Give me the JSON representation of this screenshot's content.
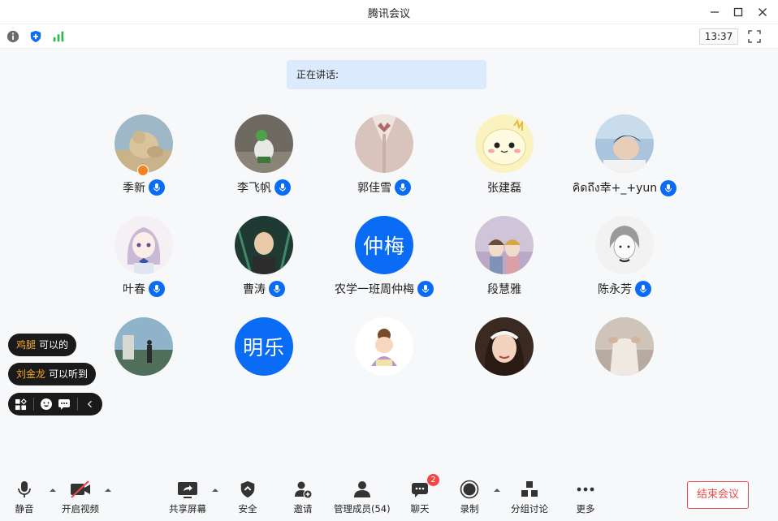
{
  "window": {
    "title": "腾讯会议"
  },
  "infobar": {
    "timer": "13:37",
    "icons": [
      "info-icon",
      "shield-icon",
      "signal-icon",
      "fullscreen-icon"
    ],
    "signal_color": "#2db84d",
    "shield_color": "#0a6cf5"
  },
  "speaking": {
    "label": "正在讲话:"
  },
  "participants": [
    {
      "name": "季新",
      "mic": true,
      "host": true,
      "avatar": "photo"
    },
    {
      "name": "李飞帆",
      "mic": true,
      "avatar": "photo"
    },
    {
      "name": "郭佳雪",
      "mic": true,
      "avatar": "photo"
    },
    {
      "name": "张建磊",
      "mic": false,
      "avatar": "cartoon"
    },
    {
      "name": "คิดถึง幸+_+yun",
      "mic": true,
      "avatar": "photo"
    },
    {
      "name": "叶春",
      "mic": true,
      "avatar": "anime"
    },
    {
      "name": "曹涛",
      "mic": true,
      "avatar": "anime"
    },
    {
      "name": "农学一班周仲梅",
      "mic": true,
      "avatar_text": "仲梅"
    },
    {
      "name": "段慧雅",
      "mic": false,
      "avatar": "illustration"
    },
    {
      "name": "陈永芳",
      "mic": true,
      "avatar": "sketch"
    },
    {
      "name": "",
      "avatar": "photo"
    },
    {
      "name": "",
      "avatar_text": "明乐"
    },
    {
      "name": "",
      "avatar": "cartoon"
    },
    {
      "name": "",
      "avatar": "photo"
    },
    {
      "name": "",
      "avatar": "photo"
    }
  ],
  "chat": {
    "messages": [
      {
        "from": "鸡腿",
        "text": "可以的"
      },
      {
        "from": "刘金龙",
        "text": "可以听到"
      }
    ]
  },
  "toolbar": {
    "mute": "静音",
    "video": "开启视频",
    "share": "共享屏幕",
    "security": "安全",
    "invite": "邀请",
    "members": "管理成员(54)",
    "chat": "聊天",
    "chat_badge": "2",
    "record": "录制",
    "breakout": "分组讨论",
    "more": "更多",
    "end": "结束会议"
  },
  "colors": {
    "accent": "#0a6cf5",
    "end_red": "#e84a4a",
    "badge_red": "#f04747",
    "chat_name": "#f5a623"
  }
}
